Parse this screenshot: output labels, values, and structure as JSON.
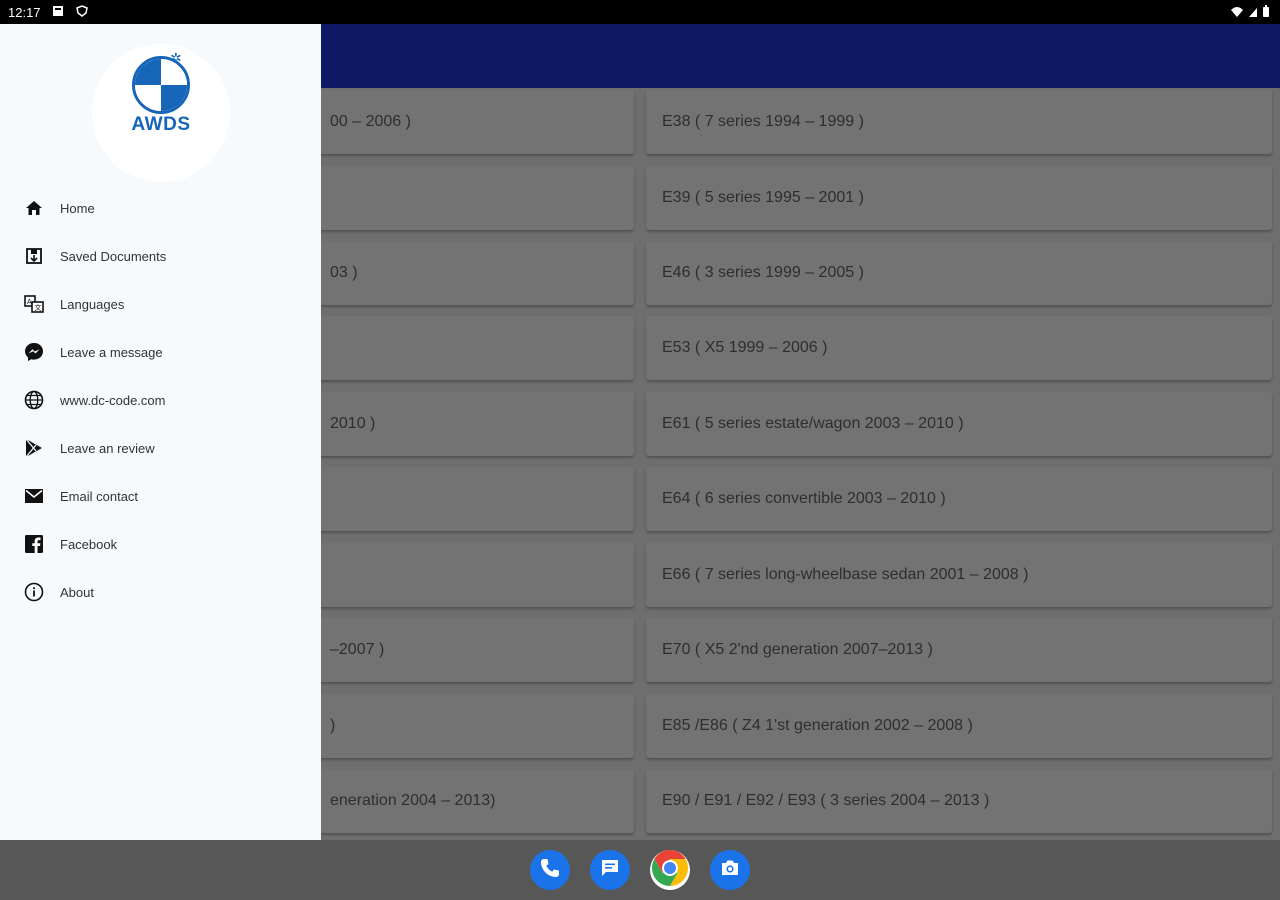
{
  "status_bar": {
    "time": "12:17"
  },
  "drawer": {
    "logo_text": "AWDS",
    "menu": [
      {
        "label": "Home",
        "icon": "home-icon"
      },
      {
        "label": "Saved Documents",
        "icon": "saved-documents-icon"
      },
      {
        "label": "Languages",
        "icon": "translate-icon"
      },
      {
        "label": "Leave a message",
        "icon": "messenger-icon"
      },
      {
        "label": "www.dc-code.com",
        "icon": "globe-icon"
      },
      {
        "label": "Leave an review",
        "icon": "play-store-icon"
      },
      {
        "label": "Email contact",
        "icon": "mail-icon"
      },
      {
        "label": "Facebook",
        "icon": "facebook-icon"
      },
      {
        "label": "About",
        "icon": "info-icon"
      }
    ]
  },
  "list": {
    "left": [
      "00 – 2006 )",
      "",
      "03 )",
      "",
      "2010 )",
      "",
      "",
      "–2007 )",
      ")",
      "eneration 2004 – 2013)"
    ],
    "right": [
      "E38 ( 7 series 1994 – 1999 )",
      "E39 ( 5 series 1995 – 2001 )",
      "E46 ( 3 series 1999 – 2005 )",
      "E53 ( X5 1999 – 2006 )",
      "E61 ( 5 series estate/wagon 2003 – 2010 )",
      "E64 ( 6 series convertible 2003 – 2010 )",
      "E66 ( 7 series long-wheelbase sedan 2001 – 2008 )",
      "E70 ( X5 2'nd generation 2007–2013 )",
      "E85 /E86 ( Z4 1'st generation 2002 – 2008 )",
      "E90 / E91 / E92 / E93 ( 3 series 2004 – 2013 )"
    ]
  },
  "dock": [
    {
      "name": "phone-icon",
      "color": "#1a73e8"
    },
    {
      "name": "messages-icon",
      "color": "#1a73e8"
    },
    {
      "name": "chrome-icon",
      "color": "#ffffff"
    },
    {
      "name": "camera-icon",
      "color": "#1a73e8"
    }
  ],
  "colors": {
    "app_bar": "#0d1a63",
    "drawer_bg": "#f7fafd",
    "brand_blue": "#1665b8"
  }
}
